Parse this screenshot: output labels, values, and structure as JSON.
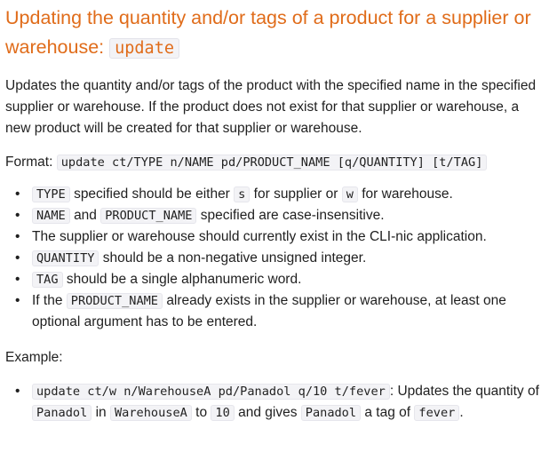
{
  "heading": {
    "text": "Updating the quantity and/or tags of a product for a supplier or warehouse:",
    "code": "update"
  },
  "description": "Updates the quantity and/or tags of the product with the specified name in the specified supplier or warehouse. If the product does not exist for that supplier or warehouse, a new product will be created for that supplier or warehouse.",
  "format": {
    "label": "Format:",
    "command": "update ct/TYPE n/NAME pd/PRODUCT_NAME [q/QUANTITY] [t/TAG]"
  },
  "rules": {
    "r1": {
      "c1": "TYPE",
      "t1": "specified should be either",
      "c2": "s",
      "t2": "for supplier or",
      "c3": "w",
      "t3": "for warehouse."
    },
    "r2": {
      "c1": "NAME",
      "t1": "and",
      "c2": "PRODUCT_NAME",
      "t2": "specified are case-insensitive."
    },
    "r3": {
      "t1": "The supplier or warehouse should currently exist in the CLI-nic application."
    },
    "r4": {
      "c1": "QUANTITY",
      "t1": "should be a non-negative unsigned integer."
    },
    "r5": {
      "c1": "TAG",
      "t1": "should be a single alphanumeric word."
    },
    "r6": {
      "t0": "If the",
      "c1": "PRODUCT_NAME",
      "t1": "already exists in the supplier or warehouse, at least one optional argument has to be entered."
    }
  },
  "example": {
    "label": "Example:",
    "command": "update ct/w n/WarehouseA pd/Panadol q/10 t/fever",
    "t1": ": Updates the quantity of",
    "c1": "Panadol",
    "t2": "in",
    "c2": "WarehouseA",
    "t3": "to",
    "c3": "10",
    "t4": "and gives",
    "c4": "Panadol",
    "t5": "a tag of",
    "c5": "fever",
    "t6": "."
  }
}
